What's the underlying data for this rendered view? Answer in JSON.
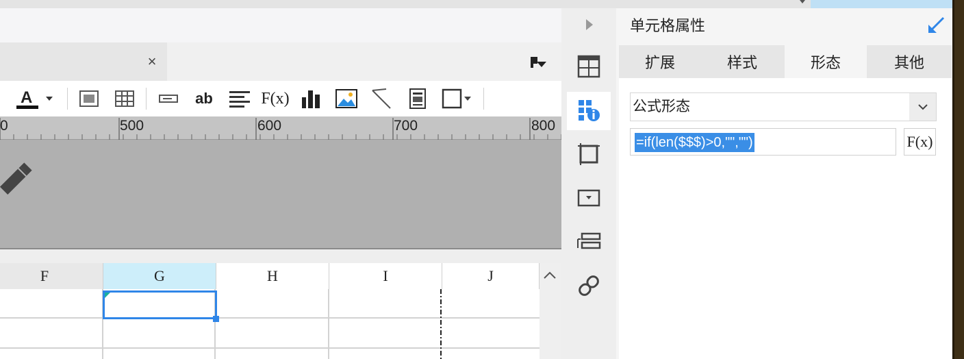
{
  "designer": {
    "ruler_labels": [
      "0",
      "500",
      "600",
      "700",
      "800"
    ],
    "columns": [
      "F",
      "G",
      "H",
      "I",
      "J"
    ],
    "selected_column": "G"
  },
  "toolbar": {
    "icons": [
      "font-color-icon",
      "dropdown-arrow-icon",
      "merge-cells-icon",
      "split-cells-icon",
      "text-field-icon",
      "text-icon",
      "align-icon",
      "formula-icon",
      "chart-icon",
      "image-icon",
      "slash-icon",
      "rich-text-icon",
      "border-icon"
    ],
    "text_icon_label": "ab",
    "formula_label": "F(x)"
  },
  "side_icons": [
    "expand-arrow-icon",
    "freeze-icon",
    "cell-attr-icon",
    "frame-icon",
    "widget-icon",
    "layer-icon",
    "link-icon"
  ],
  "panel": {
    "title": "单元格属性",
    "tabs": [
      {
        "label": "扩展",
        "active": false
      },
      {
        "label": "样式",
        "active": false
      },
      {
        "label": "形态",
        "active": true
      },
      {
        "label": "其他",
        "active": false
      }
    ],
    "form_select": "公式形态",
    "formula": "=if(len($$$)>0,\"\",\"\")",
    "formula_button": "F(x)"
  },
  "colors": {
    "accent": "#2f86e8",
    "selection": "#3a8ee6",
    "header_highlight": "#cdeefa"
  }
}
